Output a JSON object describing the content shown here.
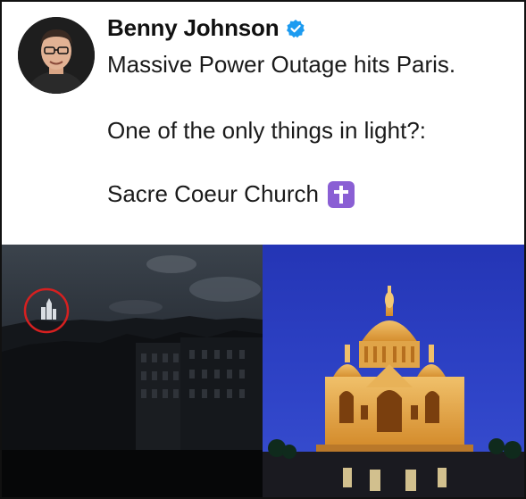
{
  "tweet": {
    "author_name": "Benny Johnson",
    "verified_icon": "verified-badge-icon",
    "text_line_1": "Massive Power Outage hits Paris.",
    "text_line_2": "One of the only things in light?:",
    "text_line_3": "Sacre Coeur Church",
    "emoji": "latin-cross-emoji"
  },
  "media": {
    "left_image": "dark-paris-skyline-photo",
    "right_image": "sacre-coeur-illuminated-photo"
  },
  "colors": {
    "verified_blue": "#1d9bf0",
    "emoji_purple": "#8a5fd4",
    "highlight_circle_red": "#d62020"
  }
}
